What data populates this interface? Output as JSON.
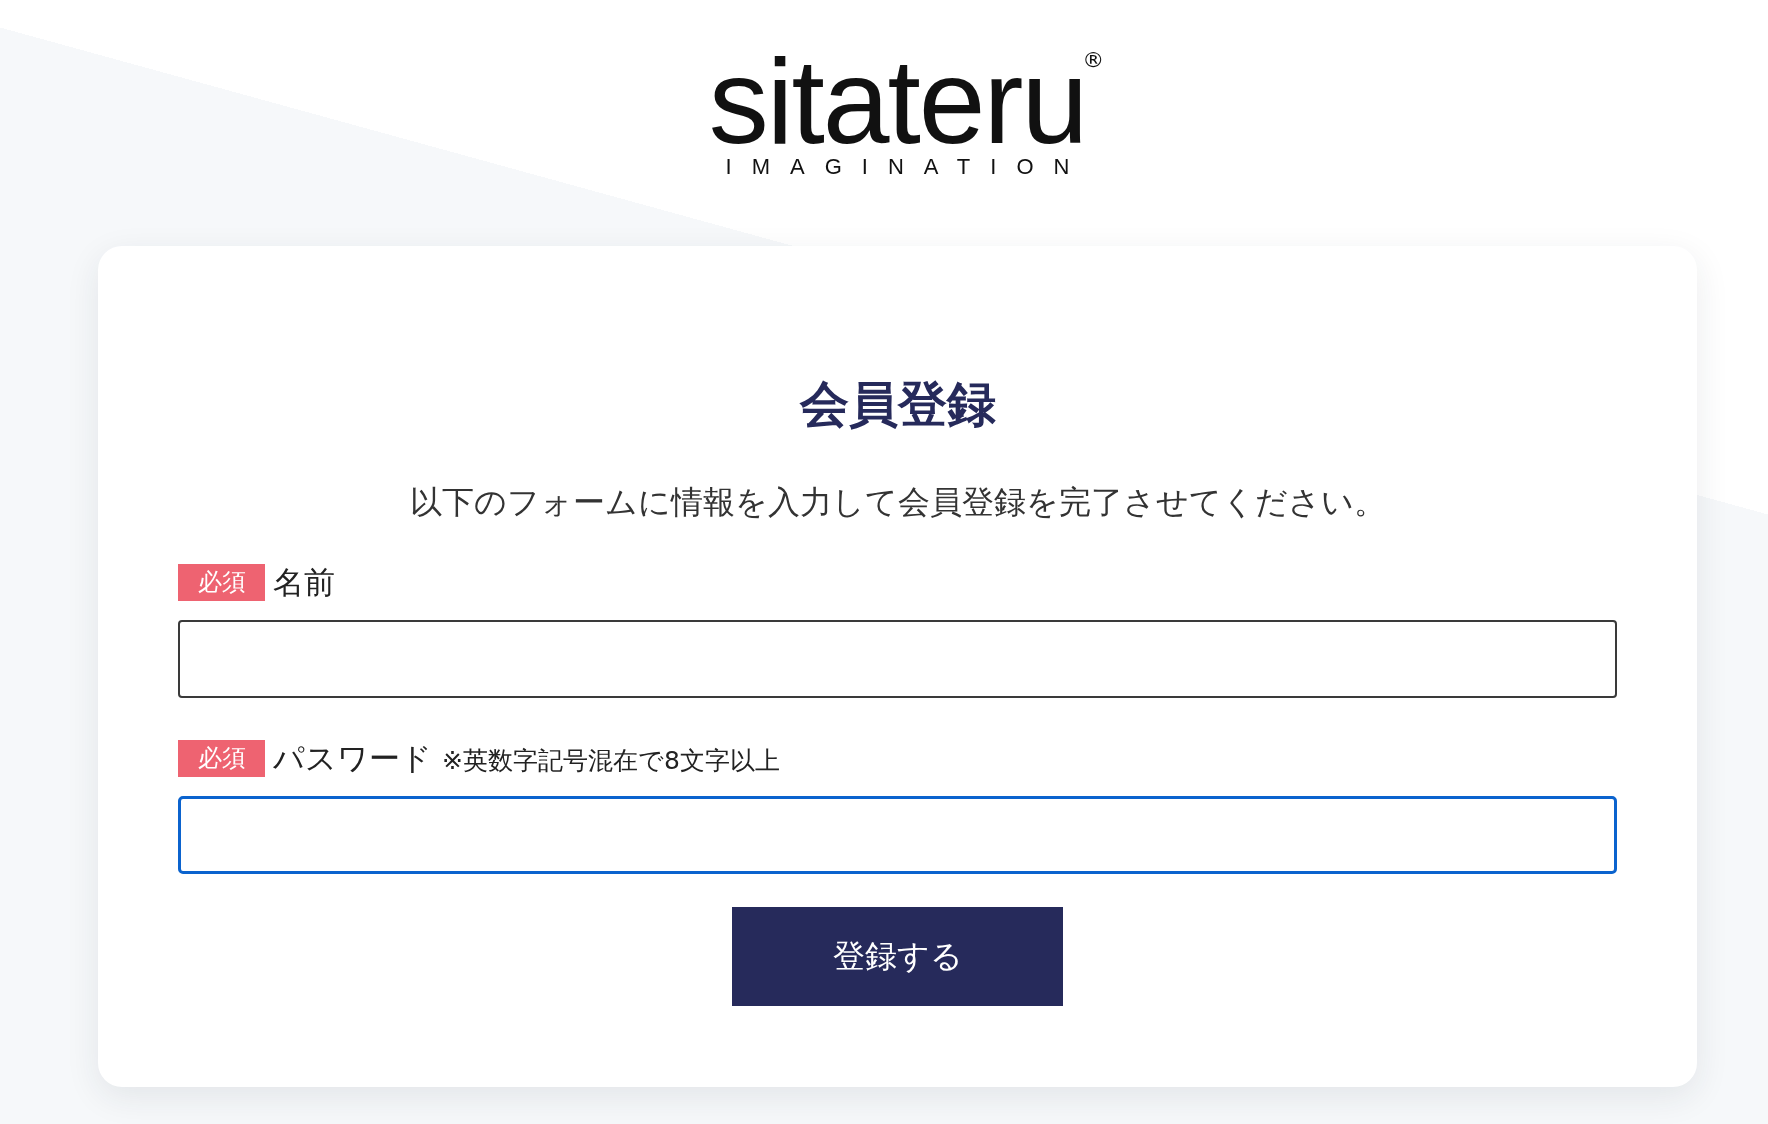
{
  "logo": {
    "wordmark": "sitateru",
    "registered_mark": "®",
    "tagline": "IMAGINATION"
  },
  "form": {
    "title": "会員登録",
    "description": "以下のフォームに情報を入力して会員登録を完了させてください。",
    "fields": [
      {
        "required_badge": "必須",
        "label": "名前",
        "focused": false
      },
      {
        "required_badge": "必須",
        "label": "パスワード",
        "note": "※英数字記号混在で8文字以上",
        "focused": true
      }
    ],
    "submit_button": "登録する"
  }
}
